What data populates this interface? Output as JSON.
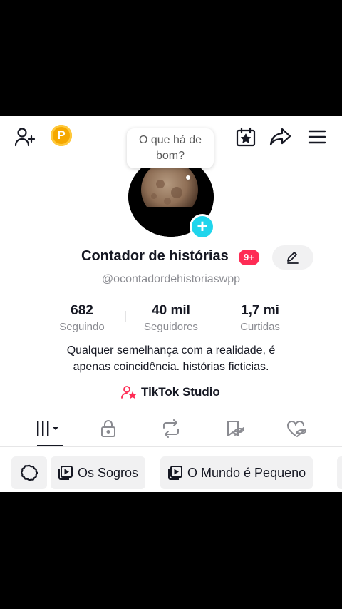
{
  "header": {
    "add_friend_icon": "person-plus-icon",
    "coin_letter": "P",
    "calendar_icon": "calendar-star-icon",
    "share_icon": "share-arrow-icon",
    "menu_icon": "hamburger-menu-icon"
  },
  "status_bubble": {
    "line1": "O que há de",
    "line2": "bom?"
  },
  "profile": {
    "name": "Contador de histórias",
    "notification_badge": "9+",
    "handle": "@ocontadordehistoriaswpp",
    "bio_line1": "Qualquer semelhança com a realidade, é",
    "bio_line2": "apenas coincidência. histórias ficticias.",
    "studio_link": "TikTok Studio"
  },
  "stats": [
    {
      "value": "682",
      "label": "Seguindo"
    },
    {
      "value": "40 mil",
      "label": "Seguidores"
    },
    {
      "value": "1,7 mi",
      "label": "Curtidas"
    }
  ],
  "tabs": [
    {
      "icon": "videos-grid-icon"
    },
    {
      "icon": "lock-icon"
    },
    {
      "icon": "repost-icon"
    },
    {
      "icon": "saved-hidden-icon"
    },
    {
      "icon": "liked-hidden-icon"
    }
  ],
  "playlists": {
    "settings_icon": "gear-icon",
    "items": [
      {
        "label": "Os Sogros",
        "icon": "playlist-icon"
      },
      {
        "label": "O Mundo é Pequeno",
        "icon": "playlist-icon"
      }
    ]
  },
  "colors": {
    "accent_pink": "#FE2C55",
    "accent_cyan": "#20D5EC",
    "coin": "#F5A800",
    "secondary_text": "#8a8b91"
  }
}
